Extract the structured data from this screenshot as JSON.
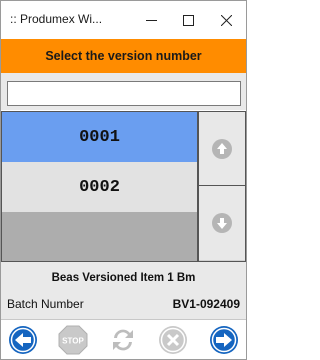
{
  "window": {
    "title": ":: Produmex Wi...",
    "controls": [
      "minimize-icon",
      "maximize-icon",
      "close-icon"
    ]
  },
  "header": {
    "title": "Select the version number"
  },
  "search": {
    "value": "",
    "placeholder": ""
  },
  "list": {
    "items": [
      {
        "label": "0001",
        "selected": true
      },
      {
        "label": "0002",
        "selected": false
      }
    ]
  },
  "scroll": {
    "up_icon": "arrow-up-icon",
    "down_icon": "arrow-down-icon"
  },
  "info": {
    "item_description": "Beas Versioned Item 1 Bm",
    "batch_label": "Batch Number",
    "batch_value": "BV1-092409"
  },
  "toolbar": {
    "buttons": [
      {
        "icon": "back-arrow-icon",
        "enabled": true
      },
      {
        "icon": "stop-icon",
        "label": "STOP",
        "enabled": false
      },
      {
        "icon": "refresh-icon",
        "enabled": false
      },
      {
        "icon": "cancel-icon",
        "enabled": false
      },
      {
        "icon": "forward-arrow-icon",
        "enabled": true
      }
    ]
  },
  "colors": {
    "header_bg": "#ff8c00",
    "selected_row": "#6a9ef0",
    "nav_blue": "#1565c0"
  }
}
